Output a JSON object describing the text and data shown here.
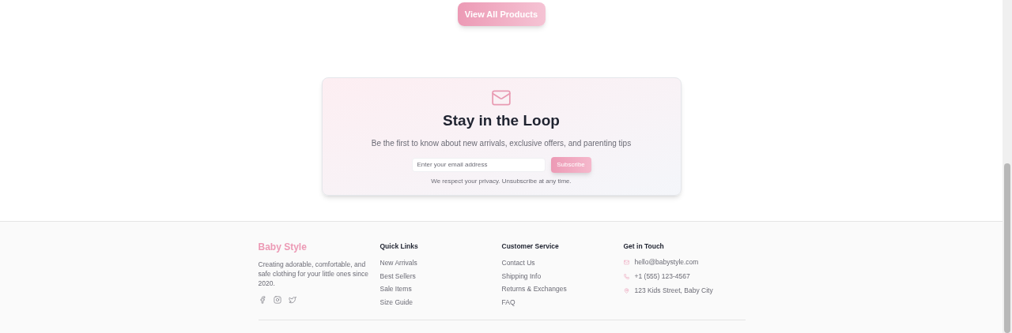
{
  "products_button": {
    "label": "View All Products"
  },
  "newsletter": {
    "title": "Stay in the Loop",
    "subtitle": "Be the first to know about new arrivals, exclusive offers, and parenting tips",
    "email_field": {
      "placeholder": "Enter your email address"
    },
    "button": "Subscribe",
    "note": "We respect your privacy. Unsubscribe at any time."
  },
  "footer": {
    "brand": {
      "name": "Baby Style",
      "description": "Creating adorable, comfortable, and safe clothing for your little ones since 2020.",
      "social": [
        {
          "kind": "facebook"
        },
        {
          "kind": "instagram"
        },
        {
          "kind": "twitter"
        }
      ]
    },
    "columns": [
      {
        "title": "Quick Links",
        "links": [
          "New Arrivals",
          "Best Sellers",
          "Sale Items",
          "Size Guide"
        ]
      },
      {
        "title": "Customer Service",
        "links": [
          "Contact Us",
          "Shipping Info",
          "Returns & Exchanges",
          "FAQ"
        ]
      }
    ],
    "contact": {
      "title": "Get in Touch",
      "items": [
        {
          "kind": "email",
          "text": "hello@babystyle.com"
        },
        {
          "kind": "phone",
          "text": "+1 (555) 123-4567"
        },
        {
          "kind": "location",
          "text": "123 Kids Street, Baby City"
        }
      ]
    }
  }
}
